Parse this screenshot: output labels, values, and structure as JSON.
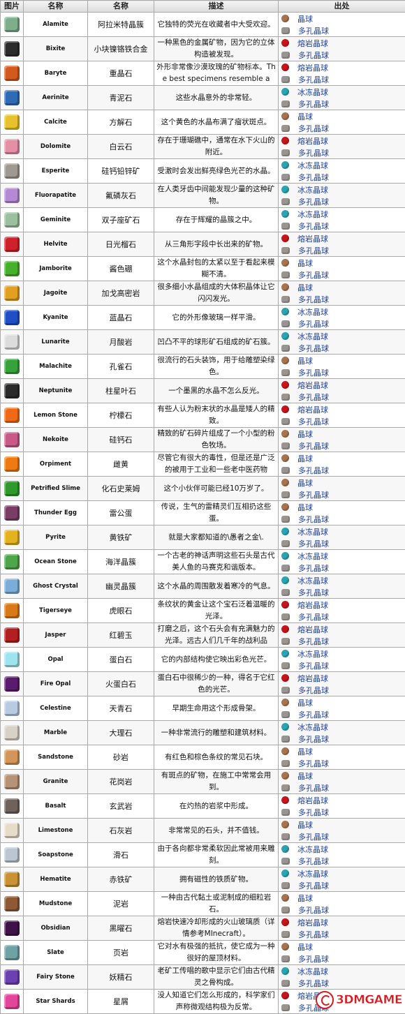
{
  "headers": [
    "图片",
    "名称",
    "名称",
    "描述",
    "出处"
  ],
  "colors": {
    "geode": "#a8734f",
    "magma": "#c8141b",
    "frozen": "#2aa3b3",
    "omni": "#9a9490",
    "link": "#1c3d9c"
  },
  "watermark": "3DMGAME",
  "rows": [
    {
      "icon": "alamite-icon",
      "color": "#7fae8c",
      "en": "Alamite",
      "cn": "阿拉米特晶簇",
      "desc": "它独特的荧光在收藏者中大受欢迎。",
      "sources": [
        {
          "type": "geode",
          "label": "晶球"
        },
        {
          "type": "omni",
          "label": "多孔晶球"
        }
      ]
    },
    {
      "icon": "bixite-icon",
      "color": "#2b2b2b",
      "en": "Bixite",
      "cn": "小块镍铬铁合金",
      "desc": "一种黑色的金属矿物，因为它的立体构造被发现。",
      "sources": [
        {
          "type": "magma",
          "label": "熔岩晶球"
        },
        {
          "type": "omni",
          "label": "多孔晶球"
        }
      ]
    },
    {
      "icon": "baryte-icon",
      "color": "#d35a1e",
      "en": "Baryte",
      "cn": "重晶石",
      "desc": "外形非常像沙漠玫瑰的矿物标本。The best specimens resemble a",
      "sources": [
        {
          "type": "magma",
          "label": "熔岩晶球"
        },
        {
          "type": "omni",
          "label": "多孔晶球"
        }
      ]
    },
    {
      "icon": "aerinite-icon",
      "color": "#2f6bb5",
      "en": "Aerinite",
      "cn": "青泥石",
      "desc": "这些水晶意外的非常轻。",
      "sources": [
        {
          "type": "frozen",
          "label": "冰冻晶球"
        },
        {
          "type": "omni",
          "label": "多孔晶球"
        }
      ]
    },
    {
      "icon": "calcite-icon",
      "color": "#e8c22d",
      "en": "Calcite",
      "cn": "方解石",
      "desc": "这个黄色的水晶布满了瘤状斑点。",
      "sources": [
        {
          "type": "geode",
          "label": "晶球"
        },
        {
          "type": "omni",
          "label": "多孔晶球"
        }
      ]
    },
    {
      "icon": "dolomite-icon",
      "color": "#e58fa7",
      "en": "Dolomite",
      "cn": "白云石",
      "desc": "存在于珊瑚礁中，通常在水下火山的附近。",
      "sources": [
        {
          "type": "magma",
          "label": "熔岩晶球"
        },
        {
          "type": "omni",
          "label": "多孔晶球"
        }
      ]
    },
    {
      "icon": "esperite-icon",
      "color": "#9e9a92",
      "en": "Esperite",
      "cn": "硅钙铅锌矿",
      "desc": "受激时会发出鲜亮绿色光芒的水晶。",
      "sources": [
        {
          "type": "frozen",
          "label": "冰冻晶球"
        },
        {
          "type": "omni",
          "label": "多孔晶球"
        }
      ]
    },
    {
      "icon": "fluorapatite-icon",
      "color": "#b589d6",
      "en": "Fluorapatite",
      "cn": "氟磷灰石",
      "desc": "在人类牙齿中间能发现少量的这种矿物。",
      "sources": [
        {
          "type": "frozen",
          "label": "冰冻晶球"
        },
        {
          "type": "omni",
          "label": "多孔晶球"
        }
      ]
    },
    {
      "icon": "geminite-icon",
      "color": "#9cbfa0",
      "en": "Geminite",
      "cn": "双子座矿石",
      "desc": "存在于辉耀的晶簇之中。",
      "sources": [
        {
          "type": "frozen",
          "label": "冰冻晶球"
        },
        {
          "type": "omni",
          "label": "多孔晶球"
        }
      ]
    },
    {
      "icon": "helvite-icon",
      "color": "#d0202a",
      "en": "Helvite",
      "cn": "日光榴石",
      "desc": "从三角形字段中长出来的矿物。",
      "sources": [
        {
          "type": "magma",
          "label": "熔岩晶球"
        },
        {
          "type": "omni",
          "label": "多孔晶球"
        }
      ]
    },
    {
      "icon": "jamborite-icon",
      "color": "#46b02c",
      "en": "Jamborite",
      "cn": "酱色硼",
      "desc": "这个水晶封包的太紧以至于看起来模糊不清。",
      "sources": [
        {
          "type": "geode",
          "label": "晶球"
        },
        {
          "type": "omni",
          "label": "多孔晶球"
        }
      ]
    },
    {
      "icon": "jagoite-icon",
      "color": "#e1a01f",
      "en": "Jagoite",
      "cn": "加戈高密岩",
      "desc": "很多细小水晶组成的大体积晶体让它闪闪发光。",
      "sources": [
        {
          "type": "geode",
          "label": "晶球"
        },
        {
          "type": "omni",
          "label": "多孔晶球"
        }
      ]
    },
    {
      "icon": "kyanite-icon",
      "color": "#1f4fc2",
      "en": "Kyanite",
      "cn": "蓝晶石",
      "desc": "它的外形像玻璃一样平滑。",
      "sources": [
        {
          "type": "frozen",
          "label": "冰冻晶球"
        },
        {
          "type": "omni",
          "label": "多孔晶球"
        }
      ]
    },
    {
      "icon": "lunarite-icon",
      "color": "#dcdcdc",
      "en": "Lunarite",
      "cn": "月酸岩",
      "desc": "凹凸不平的球形矿石组成的矿石簇。",
      "sources": [
        {
          "type": "frozen",
          "label": "冰冻晶球"
        },
        {
          "type": "omni",
          "label": "多孔晶球"
        }
      ]
    },
    {
      "icon": "malachite-icon",
      "color": "#37a13c",
      "en": "Malachite",
      "cn": "孔雀石",
      "desc": "很流行的石头装饰，用于给雕塑染绿色。",
      "sources": [
        {
          "type": "geode",
          "label": "晶球"
        },
        {
          "type": "omni",
          "label": "多孔晶球"
        }
      ]
    },
    {
      "icon": "neptunite-icon",
      "color": "#2a2a2a",
      "en": "Neptunite",
      "cn": "柱星叶石",
      "desc": "一个墨黑的水晶不怎么反光。",
      "sources": [
        {
          "type": "magma",
          "label": "熔岩晶球"
        },
        {
          "type": "omni",
          "label": "多孔晶球"
        }
      ]
    },
    {
      "icon": "lemon-stone-icon",
      "color": "#ef6a16",
      "en": "Lemon Stone",
      "cn": "柠檬石",
      "desc": "有些人认为粉末状的水晶是矮人的精致。",
      "sources": [
        {
          "type": "magma",
          "label": "熔岩晶球"
        },
        {
          "type": "omni",
          "label": "多孔晶球"
        }
      ]
    },
    {
      "icon": "nekoite-icon",
      "color": "#c85a88",
      "en": "Nekoite",
      "cn": "硅钙石",
      "desc": "精致的矿石碎片组成了一个小型的粉色牧场。",
      "sources": [
        {
          "type": "geode",
          "label": "晶球"
        },
        {
          "type": "omni",
          "label": "多孔晶球"
        }
      ]
    },
    {
      "icon": "orpiment-icon",
      "color": "#ee7a12",
      "en": "Orpiment",
      "cn": "雌黄",
      "desc": "尽管它有很大的毒性，但是还是广泛的被用于工业和一些老中医药物",
      "sources": [
        {
          "type": "geode",
          "label": "晶球"
        },
        {
          "type": "omni",
          "label": "多孔晶球"
        }
      ]
    },
    {
      "icon": "petrified-slime-icon",
      "color": "#2f9a2b",
      "en": "Petrified Slime",
      "cn": "化石史莱姆",
      "desc": "这个小伙伴可能已经10万岁了。",
      "sources": [
        {
          "type": "geode",
          "label": "晶球"
        },
        {
          "type": "omni",
          "label": "多孔晶球"
        }
      ]
    },
    {
      "icon": "thunder-egg-icon",
      "color": "#7a3d66",
      "en": "Thunder Egg",
      "cn": "雷公蛋",
      "desc": "传说，生气的雷精灵们互相扔这些蛋。",
      "sources": [
        {
          "type": "geode",
          "label": "晶球"
        },
        {
          "type": "omni",
          "label": "多孔晶球"
        }
      ]
    },
    {
      "icon": "pyrite-icon",
      "color": "#e5b21f",
      "en": "Pyrite",
      "cn": "黄铁矿",
      "desc": "就是大家都知道的\\愚者之金\\.",
      "sources": [
        {
          "type": "frozen",
          "label": "冰冻晶球"
        },
        {
          "type": "omni",
          "label": "多孔晶球"
        }
      ]
    },
    {
      "icon": "ocean-stone-icon",
      "color": "#4fa64a",
      "en": "Ocean Stone",
      "cn": "海洋晶簇",
      "desc": "一个古老的神话声明这些石头是古代美人鱼的马赛克和谐版本。",
      "sources": [
        {
          "type": "frozen",
          "label": "冰冻晶球"
        },
        {
          "type": "omni",
          "label": "多孔晶球"
        }
      ]
    },
    {
      "icon": "ghost-crystal-icon",
      "color": "#7aaed8",
      "en": "Ghost Crystal",
      "cn": "幽灵晶簇",
      "desc": "这个水晶的周围散发着寒冷的气息。",
      "sources": [
        {
          "type": "frozen",
          "label": "冰冻晶球"
        },
        {
          "type": "omni",
          "label": "多孔晶球"
        }
      ]
    },
    {
      "icon": "tigerseye-icon",
      "color": "#d97a19",
      "en": "Tigerseye",
      "cn": "虎眼石",
      "desc": "条纹状的黄金让这个宝石泛着温暖的光泽。",
      "sources": [
        {
          "type": "magma",
          "label": "熔岩晶球"
        },
        {
          "type": "omni",
          "label": "多孔晶球"
        }
      ]
    },
    {
      "icon": "jasper-icon",
      "color": "#b31e1e",
      "en": "Jasper",
      "cn": "红碧玉",
      "desc": "打磨之后，这个石头会有充满魅力的光泽。远古人们几千年的战利品",
      "sources": [
        {
          "type": "magma",
          "label": "熔岩晶球"
        },
        {
          "type": "omni",
          "label": "多孔晶球"
        }
      ]
    },
    {
      "icon": "opal-icon",
      "color": "#9fe3ee",
      "en": "Opal",
      "cn": "蛋白石",
      "desc": "它的内部结构使它映出彩色光芒。",
      "sources": [
        {
          "type": "frozen",
          "label": "冰冻晶球"
        },
        {
          "type": "omni",
          "label": "多孔晶球"
        }
      ]
    },
    {
      "icon": "fire-opal-icon",
      "color": "#5a1a6e",
      "en": "Fire Opal",
      "cn": "火蛋白石",
      "desc": "蛋白石中很稀少的一种，得名于它红色的光芒。",
      "sources": [
        {
          "type": "magma",
          "label": "熔岩晶球"
        },
        {
          "type": "omni",
          "label": "多孔晶球"
        }
      ]
    },
    {
      "icon": "celestine-icon",
      "color": "#b9cbe3",
      "en": "Celestine",
      "cn": "天青石",
      "desc": "早期生命用这个形成骨架。",
      "sources": [
        {
          "type": "geode",
          "label": "晶球"
        },
        {
          "type": "omni",
          "label": "多孔晶球"
        }
      ]
    },
    {
      "icon": "marble-icon",
      "color": "#d8d2c6",
      "en": "Marble",
      "cn": "大理石",
      "desc": "一种非常流行的雕塑和建筑材料。",
      "sources": [
        {
          "type": "frozen",
          "label": "冰冻晶球"
        },
        {
          "type": "omni",
          "label": "多孔晶球"
        }
      ]
    },
    {
      "icon": "sandstone-icon",
      "color": "#d2955a",
      "en": "Sandstone",
      "cn": "砂岩",
      "desc": "有红色和棕色条纹的常见石块。",
      "sources": [
        {
          "type": "geode",
          "label": "晶球"
        },
        {
          "type": "omni",
          "label": "多孔晶球"
        }
      ]
    },
    {
      "icon": "granite-icon",
      "color": "#b69276",
      "en": "Granite",
      "cn": "花岗岩",
      "desc": "有斑点的矿物，在施工中常常会用到。",
      "sources": [
        {
          "type": "geode",
          "label": "晶球"
        },
        {
          "type": "omni",
          "label": "多孔晶球"
        }
      ]
    },
    {
      "icon": "basalt-icon",
      "color": "#6e625a",
      "en": "Basalt",
      "cn": "玄武岩",
      "desc": "在灼热的岩浆中形成。",
      "sources": [
        {
          "type": "magma",
          "label": "熔岩晶球"
        },
        {
          "type": "omni",
          "label": "多孔晶球"
        }
      ]
    },
    {
      "icon": "limestone-icon",
      "color": "#e6dcc8",
      "en": "Limestone",
      "cn": "石灰岩",
      "desc": "非常常见的石头，并不值钱。",
      "sources": [
        {
          "type": "geode",
          "label": "晶球"
        },
        {
          "type": "omni",
          "label": "多孔晶球"
        }
      ]
    },
    {
      "icon": "soapstone-icon",
      "color": "#bcc6d2",
      "en": "Soapstone",
      "cn": "滑石",
      "desc": "由于各向都非常柔软因此常被用来雕刻。",
      "sources": [
        {
          "type": "frozen",
          "label": "冰冻晶球"
        },
        {
          "type": "omni",
          "label": "多孔晶球"
        }
      ]
    },
    {
      "icon": "hematite-icon",
      "color": "#c99233",
      "en": "Hematite",
      "cn": "赤铁矿",
      "desc": "拥有磁性的铁质矿物。",
      "sources": [
        {
          "type": "frozen",
          "label": "冰冻晶球"
        },
        {
          "type": "omni",
          "label": "多孔晶球"
        }
      ]
    },
    {
      "icon": "mudstone-icon",
      "color": "#8e5a36",
      "en": "Mudstone",
      "cn": "泥岩",
      "desc": "一种由古代黏土或泥制成的细粒岩石。",
      "sources": [
        {
          "type": "geode",
          "label": "晶球"
        },
        {
          "type": "omni",
          "label": "多孔晶球"
        }
      ]
    },
    {
      "icon": "obsidian-icon",
      "color": "#3e1248",
      "en": "Obsidian",
      "cn": "黑曜石",
      "desc": "熔岩快速冷却形成的火山玻璃质（详情参考MInecraft）。",
      "sources": [
        {
          "type": "magma",
          "label": "熔岩晶球"
        },
        {
          "type": "omni",
          "label": "多孔晶球"
        }
      ]
    },
    {
      "icon": "slate-icon",
      "color": "#6fa2a4",
      "en": "Slate",
      "cn": "页岩",
      "desc": "它对水有极强的抵抗，使它成为一种很好的屋顶材料。",
      "sources": [
        {
          "type": "geode",
          "label": "晶球"
        },
        {
          "type": "omni",
          "label": "多孔晶球"
        }
      ]
    },
    {
      "icon": "fairy-stone-icon",
      "color": "#6c3fb3",
      "en": "Fairy Stone",
      "cn": "妖精石",
      "desc": "老矿工传唱的歌中显示它们由古代精灵之骨构成。",
      "sources": [
        {
          "type": "frozen",
          "label": "冰冻晶球"
        },
        {
          "type": "omni",
          "label": "多孔晶球"
        }
      ]
    },
    {
      "icon": "star-shards-icon",
      "color": "#e2469b",
      "en": "Star Shards",
      "cn": "星屑",
      "desc": "没人知道它们怎么形成的，科学家们声称微观结构极为反常。",
      "sources": [
        {
          "type": "magma",
          "label": "熔岩晶球"
        },
        {
          "type": "omni",
          "label": "多孔晶球"
        }
      ]
    }
  ]
}
